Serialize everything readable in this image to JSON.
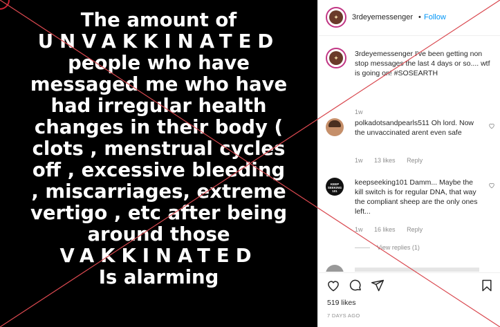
{
  "media": {
    "lines": [
      "The amount of",
      "UNVAKKINATED",
      "people who have",
      "messaged me who have",
      "had irregular health",
      "changes in their body  (",
      "clots , menstrual cycles",
      "off , excessive bleeding",
      ", miscarriages, extreme",
      "vertigo , etc after being",
      "around those",
      "VAKKINATED",
      "Is alarming"
    ]
  },
  "header": {
    "username": "3rdeyemessenger",
    "separator": "•",
    "follow_label": "Follow"
  },
  "caption": {
    "username": "3rdeyemessenger",
    "text": "I've been getting non stop messages the last 4 days or so.... wtf is going on! #SOSEARTH",
    "time": "1w"
  },
  "comments": [
    {
      "username": "polkadotsandpearls511",
      "text": "Oh lord. Now the unvaccinated arent even safe",
      "time": "1w",
      "likes": "13 likes",
      "reply": "Reply",
      "avatar": "woman-photo"
    },
    {
      "username": "keepseeking101",
      "text": "Damm... Maybe the kill switch is for regular DNA, that way the compliant sheep are the only ones left...",
      "time": "1w",
      "likes": "16 likes",
      "reply": "Reply",
      "avatar_text": "KEEP SEEKING 101"
    }
  ],
  "view_replies": "View replies (1)",
  "actions": {
    "likes_count": "519 likes",
    "posted_ago": "7 DAYS AGO",
    "icons": [
      "heart-icon",
      "comment-icon",
      "share-icon",
      "bookmark-icon"
    ]
  },
  "colors": {
    "link_blue": "#0095f6",
    "overlay_red": "#d9484f",
    "muted_gray": "#8e8e8e"
  }
}
